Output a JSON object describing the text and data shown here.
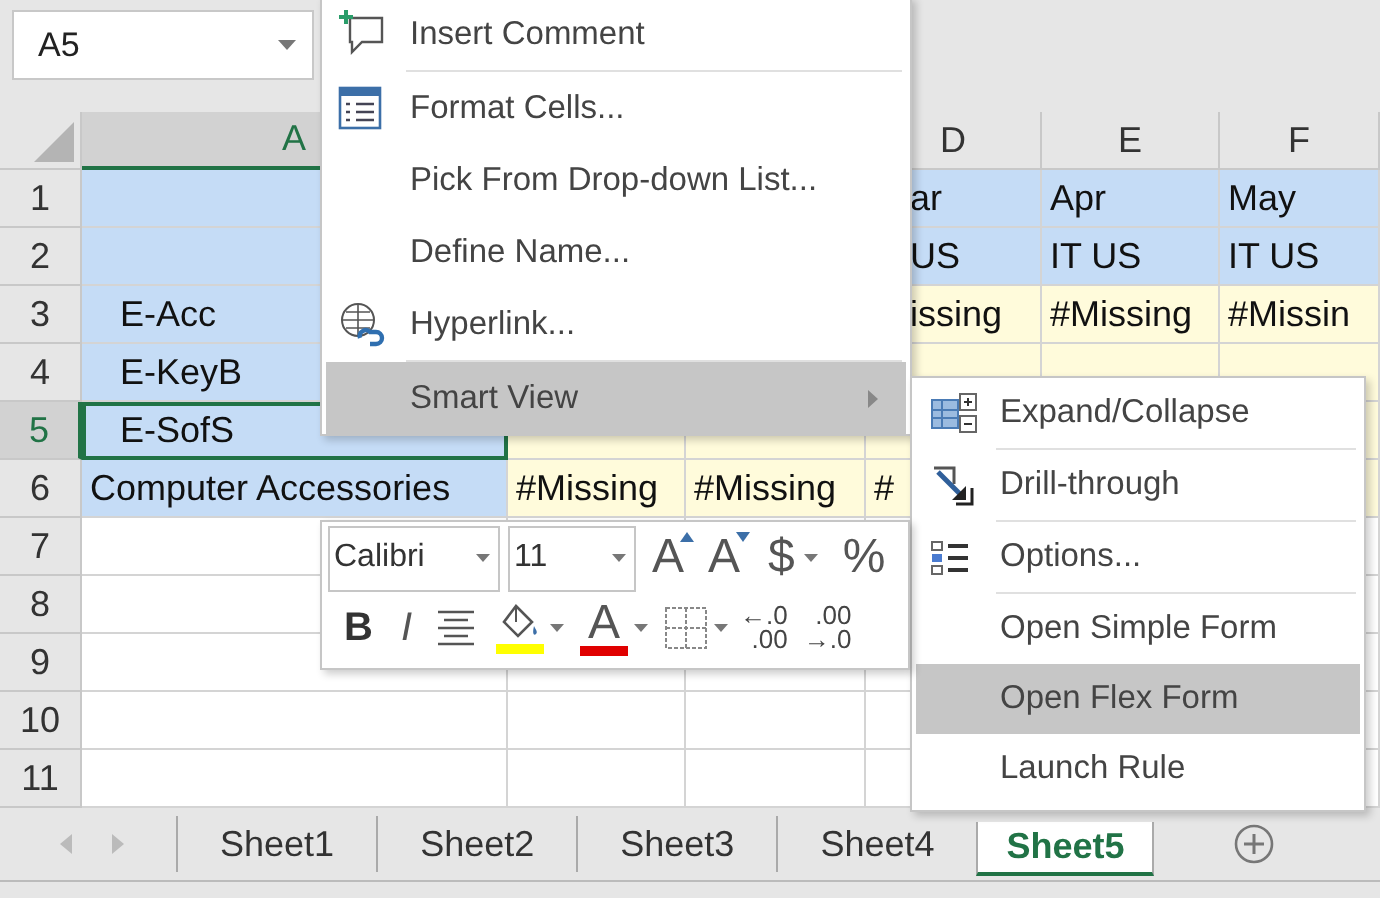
{
  "name_box": {
    "value": "A5"
  },
  "table": {
    "columns": [
      {
        "label": "A",
        "selected": true
      },
      null,
      null,
      {
        "label": "D",
        "selected": false
      },
      {
        "label": "E",
        "selected": false
      },
      {
        "label": "F",
        "selected": false
      }
    ],
    "rows": [
      {
        "label": "1",
        "kind": "header",
        "selected": false,
        "indented": false,
        "cells": [
          null,
          null,
          null,
          "ar",
          "Apr",
          "May"
        ]
      },
      {
        "label": "2",
        "kind": "header",
        "selected": false,
        "indented": false,
        "cells": [
          null,
          null,
          null,
          "US",
          "IT US",
          "IT US"
        ]
      },
      {
        "label": "3",
        "kind": "data",
        "selected": false,
        "indented": true,
        "cells": [
          "E-Acc",
          null,
          null,
          "issing",
          "#Missing",
          "#Missin"
        ]
      },
      {
        "label": "4",
        "kind": "data",
        "selected": false,
        "indented": true,
        "cells": [
          "E-KeyB",
          null,
          null,
          null,
          null,
          null
        ]
      },
      {
        "label": "5",
        "kind": "data",
        "selected": true,
        "indented": true,
        "cells": [
          "E-SofS",
          null,
          null,
          null,
          null,
          null
        ]
      },
      {
        "label": "6",
        "kind": "data",
        "selected": false,
        "indented": false,
        "cells": [
          "Computer Accessories",
          "#Missing",
          "#Missing",
          "#",
          null,
          null
        ]
      },
      {
        "label": "7",
        "kind": "empty",
        "selected": false,
        "indented": false,
        "cells": [
          null,
          null,
          null,
          null,
          null,
          null
        ]
      },
      {
        "label": "8",
        "kind": "empty",
        "selected": false,
        "indented": false,
        "cells": [
          null,
          null,
          null,
          null,
          null,
          null
        ]
      },
      {
        "label": "9",
        "kind": "empty",
        "selected": false,
        "indented": false,
        "cells": [
          null,
          null,
          null,
          null,
          null,
          null
        ]
      },
      {
        "label": "10",
        "kind": "empty",
        "selected": false,
        "indented": false,
        "cells": [
          null,
          null,
          null,
          null,
          null,
          null
        ]
      },
      {
        "label": "11",
        "kind": "empty",
        "selected": false,
        "indented": false,
        "cells": [
          null,
          null,
          null,
          null,
          null,
          null
        ]
      }
    ]
  },
  "context_menu": {
    "items": [
      {
        "kind": "comment",
        "label": "Insert Comment",
        "selected": false
      },
      {
        "kind": "separator"
      },
      {
        "kind": "format",
        "label": "Format Cells...",
        "selected": false
      },
      {
        "kind": "plain",
        "label": "Pick From Drop-down List...",
        "selected": false
      },
      {
        "kind": "plain",
        "label": "Define Name...",
        "selected": false
      },
      {
        "kind": "hyperlink",
        "label": "Hyperlink...",
        "selected": false
      },
      {
        "kind": "separator"
      },
      {
        "kind": "submenu",
        "label": "Smart View",
        "selected": true
      }
    ]
  },
  "submenu": {
    "items": [
      {
        "kind": "expand",
        "label": "Expand/Collapse",
        "selected": false
      },
      {
        "kind": "separator"
      },
      {
        "kind": "drill",
        "label": "Drill-through",
        "selected": false
      },
      {
        "kind": "separator"
      },
      {
        "kind": "options",
        "label": "Options...",
        "selected": false
      },
      {
        "kind": "separator"
      },
      {
        "kind": "plain",
        "label": "Open Simple Form",
        "selected": false
      },
      {
        "kind": "plain",
        "label": "Open Flex Form",
        "selected": true
      },
      {
        "kind": "plain",
        "label": "Launch Rule",
        "selected": false
      }
    ]
  },
  "mini_toolbar": {
    "top_row": [
      {
        "kind": "font",
        "label": "Calibri"
      },
      {
        "kind": "size",
        "label": "11"
      },
      {
        "kind": "grow",
        "label": "A"
      },
      {
        "kind": "shrink",
        "label": "A"
      },
      {
        "kind": "currency",
        "label": "$"
      },
      {
        "kind": "percent",
        "label": "%"
      }
    ],
    "bottom_row": [
      {
        "kind": "bold",
        "label": "B"
      },
      {
        "kind": "italic",
        "label": "I"
      },
      {
        "kind": "center"
      },
      {
        "kind": "fill",
        "color": "#ffff00"
      },
      {
        "kind": "fontcolor",
        "label": "A",
        "color": "#e00000"
      },
      {
        "kind": "borders"
      },
      {
        "kind": "incdec",
        "lines": [
          "←.0",
          ".00"
        ]
      },
      {
        "kind": "decdec",
        "lines": [
          ".00",
          "→.0"
        ]
      }
    ]
  },
  "sheet_tabs": {
    "tabs": [
      {
        "label": "Sheet1",
        "selected": false
      },
      {
        "label": "Sheet2",
        "selected": false
      },
      {
        "label": "Sheet3",
        "selected": false
      },
      {
        "label": "Sheet4",
        "selected": false
      },
      {
        "label": "Sheet5",
        "selected": true
      }
    ]
  }
}
